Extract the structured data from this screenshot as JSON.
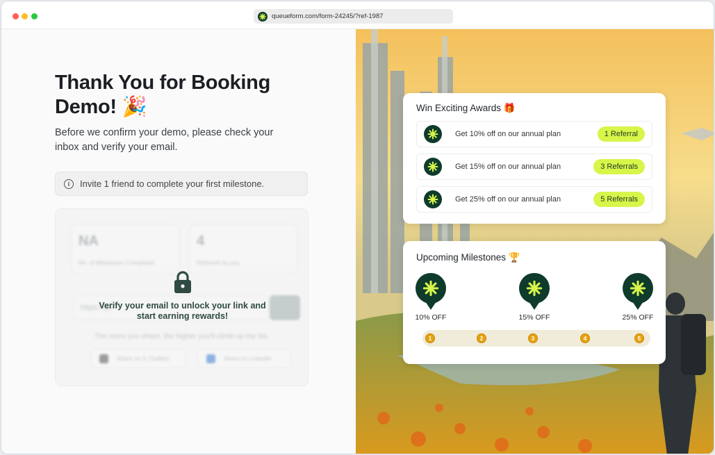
{
  "browser": {
    "url": "queueform.com/form-24245/?ref-1987"
  },
  "left": {
    "title": "Thank You for Booking Demo! 🎉",
    "subtitle": "Before we confirm your demo, please check your inbox and verify your email.",
    "info_text": "Invite 1 friend to complete your first milestone.",
    "stats": [
      {
        "value": "NA",
        "label": "No. of Milestones Completed"
      },
      {
        "value": "4",
        "label": "Referrals by you"
      }
    ],
    "link_placeholder": "https://qu",
    "lock_message": "Verify your email to unlock your link and start earning rewards!",
    "share_note": "The more you share, the higher you'll climb up the list.",
    "share_x_label": "Share on X (Twitter)",
    "share_linkedin_label": "Share on LinkedIn"
  },
  "awards": {
    "title": "Win Exciting Awards 🎁",
    "items": [
      {
        "text": "Get 10% off on our annual plan",
        "badge": "1 Referral"
      },
      {
        "text": "Get 15% off on our annual plan",
        "badge": "3 Referrals"
      },
      {
        "text": "Get 25% off on our annual plan",
        "badge": "5 Referrals"
      }
    ]
  },
  "milestones": {
    "title": "Upcoming Milestones 🏆",
    "pins": [
      {
        "label": "10% OFF"
      },
      {
        "label": "15% OFF"
      },
      {
        "label": "25% OFF"
      }
    ],
    "steps": [
      "1",
      "2",
      "3",
      "4",
      "5"
    ]
  },
  "colors": {
    "brand_dark": "#0e3b2b",
    "accent_lime": "#d8f54a",
    "step_gold": "#e5a20f"
  }
}
